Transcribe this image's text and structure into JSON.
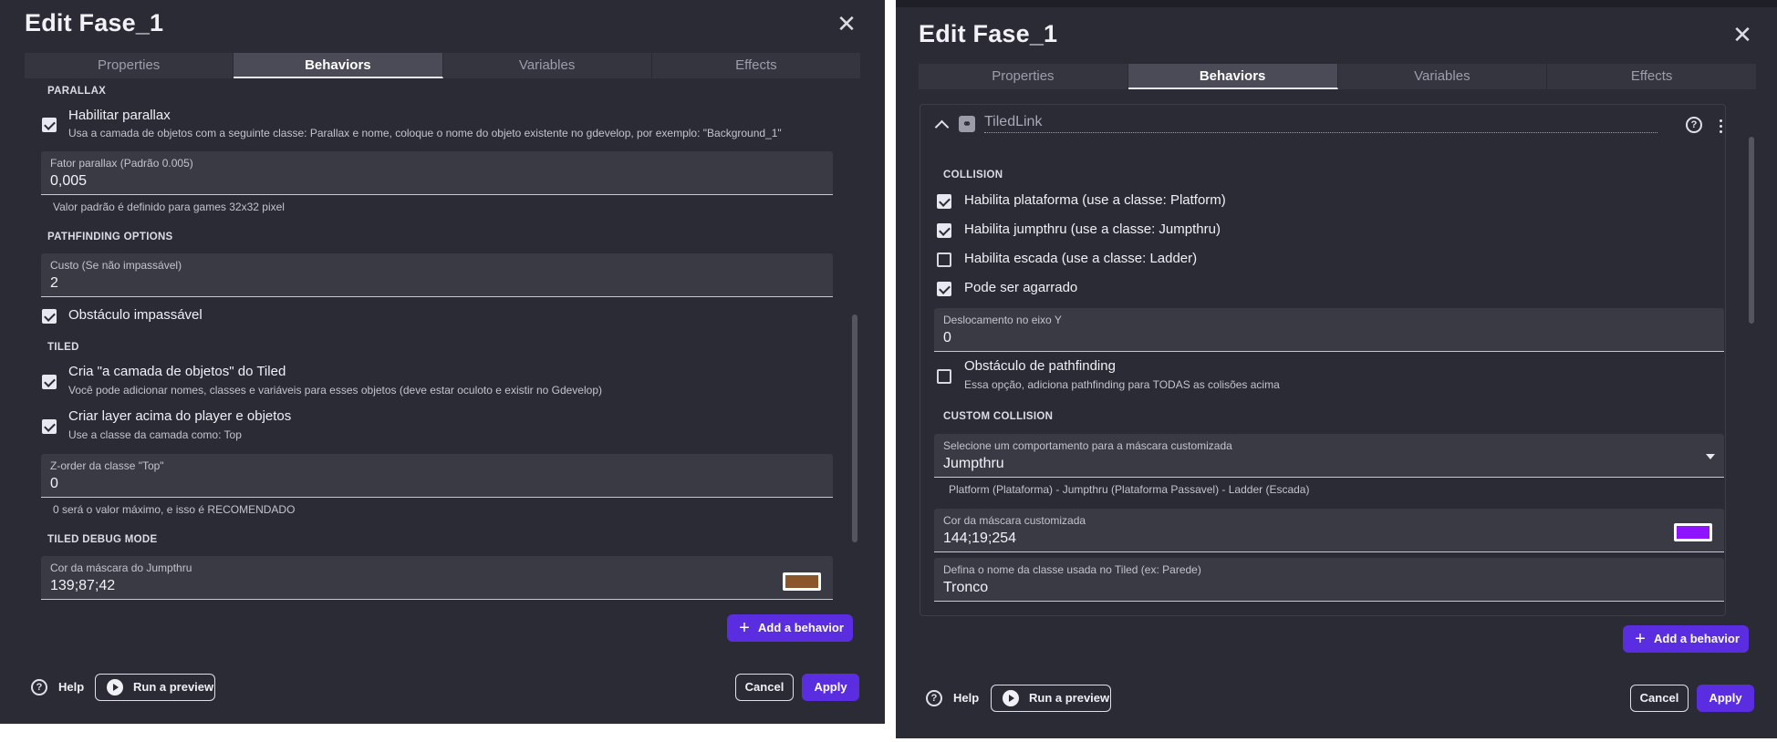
{
  "left": {
    "title": "Edit Fase_1",
    "tabs": [
      "Properties",
      "Behaviors",
      "Variables",
      "Effects"
    ],
    "active_tab": "Behaviors",
    "sections": {
      "parallax": "PARALLAX",
      "pathfinding": "PATHFINDING OPTIONS",
      "tiled": "TILED",
      "debug": "TILED DEBUG MODE"
    },
    "habilitar_parallax": {
      "label": "Habilitar parallax",
      "desc": "Usa a camada de objetos com a seguinte classe: Parallax e nome, coloque o nome do objeto existente no gdevelop, por exemplo: \"Background_1\"",
      "checked": true
    },
    "fator_parallax": {
      "label": "Fator parallax (Padrão 0.005)",
      "value": "0,005",
      "help": "Valor padrão é definido para games 32x32 pixel"
    },
    "custo": {
      "label": "Custo (Se não impassável)",
      "value": "2"
    },
    "obstaculo": {
      "label": "Obstáculo impassável",
      "checked": true
    },
    "cria_camada": {
      "label": "Cria \"a camada de objetos\" do Tiled",
      "desc": "Você pode adicionar nomes, classes e variáveis para esses objetos (deve estar oculoto e existir no Gdevelop)",
      "checked": true
    },
    "criar_layer": {
      "label": "Criar layer acima do player e objetos",
      "desc": "Use a classe da camada como: Top",
      "checked": true
    },
    "zorder": {
      "label": "Z-order da classe \"Top\"",
      "value": "0",
      "help": "0 será o valor máximo, e isso é RECOMENDADO"
    },
    "cor_jumpthru": {
      "label": "Cor da máscara do Jumpthru",
      "value": "139;87;42",
      "color": "#8b572a"
    },
    "add_behavior": "Add a behavior",
    "help": "Help",
    "run_preview": "Run a preview",
    "cancel": "Cancel",
    "apply": "Apply"
  },
  "right": {
    "title": "Edit Fase_1",
    "tabs": [
      "Properties",
      "Behaviors",
      "Variables",
      "Effects"
    ],
    "active_tab": "Behaviors",
    "behavior_name": "TiledLink",
    "sections": {
      "collision": "COLLISION",
      "custom": "CUSTOM COLLISION"
    },
    "habilita_plataforma": {
      "label": "Habilita plataforma (use a classe: Platform)",
      "checked": true
    },
    "habilita_jumpthru": {
      "label": "Habilita jumpthru (use a classe: Jumpthru)",
      "checked": true
    },
    "habilita_escada": {
      "label": "Habilita escada (use a classe: Ladder)",
      "checked": false
    },
    "pode_agarrado": {
      "label": "Pode ser agarrado",
      "checked": true
    },
    "deslocamento": {
      "label": "Deslocamento no eixo Y",
      "value": "0"
    },
    "obstaculo_pf": {
      "label": "Obstáculo de pathfinding",
      "desc": "Essa opção, adiciona pathfinding para TODAS as colisões acima",
      "checked": false
    },
    "selecione": {
      "label": "Selecione um comportamento para a máscara customizada",
      "value": "Jumpthru",
      "help": "Platform (Plataforma) - Jumpthru (Plataforma Passavel) - Ladder (Escada)"
    },
    "cor_mascara": {
      "label": "Cor da máscara customizada",
      "value": "144;19;254",
      "color": "#9013fe"
    },
    "nome_classe": {
      "label": "Defina o nome da classe usada no Tiled (ex: Parede)",
      "value": "Tronco"
    },
    "add_behavior": "Add a behavior",
    "help": "Help",
    "run_preview": "Run a preview",
    "cancel": "Cancel",
    "apply": "Apply"
  },
  "colors": {
    "accent": "#5a2ee0",
    "dialog_bg": "#2b2b36",
    "field_bg": "#3a3a45"
  }
}
